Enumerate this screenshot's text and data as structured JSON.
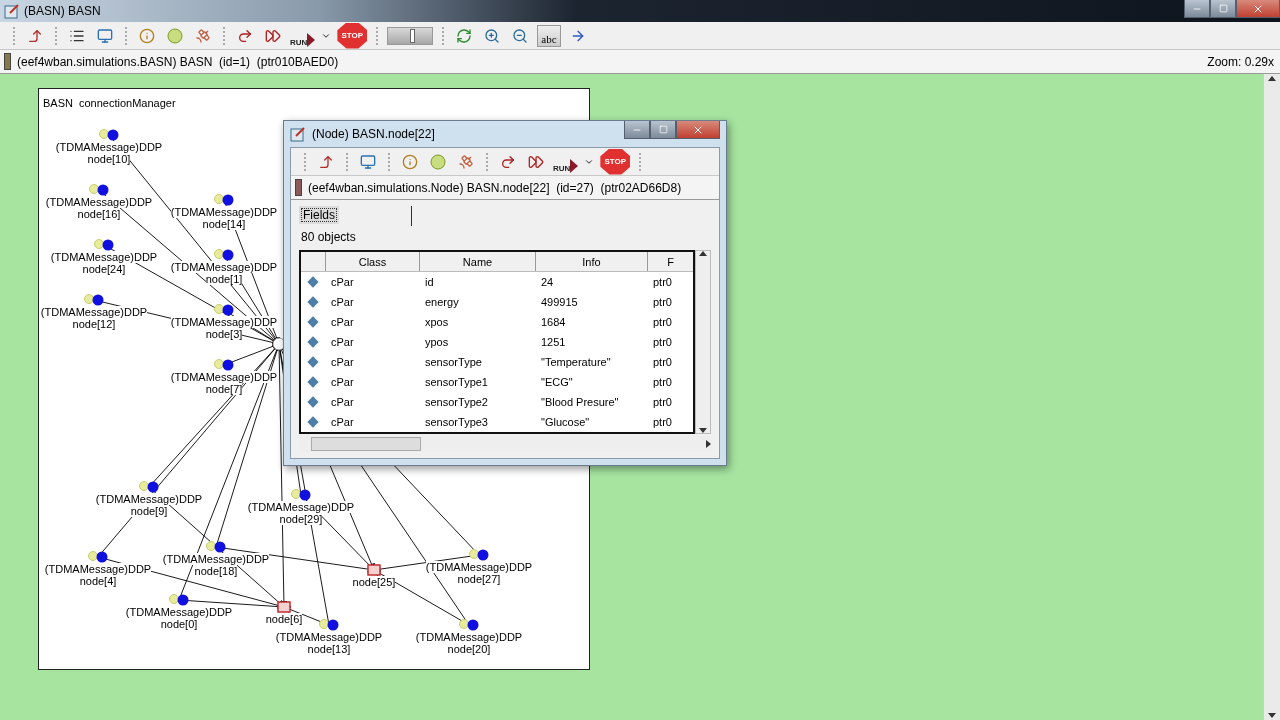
{
  "window": {
    "title": "(BASN) BASN"
  },
  "toolbar": {
    "run_label": "RUN",
    "stop_label": "STOP",
    "speed": {
      "level": 0.55
    },
    "labels_button": "abc"
  },
  "info_bar": {
    "text": "(eef4wban.simulations.BASN) BASN  (id=1)  (ptr010BAED0)",
    "zoom": "Zoom: 0.29x"
  },
  "canvas": {
    "title": "BASN",
    "module": "connectionManager",
    "nodes": [
      {
        "kind": "sensor",
        "label": "node[10]",
        "message": "(TDMAMessage)DDP"
      },
      {
        "kind": "sensor",
        "label": "node[16]",
        "message": "(TDMAMessage)DDP"
      },
      {
        "kind": "sensor",
        "label": "node[24]",
        "message": "(TDMAMessage)DDP"
      },
      {
        "kind": "sensor",
        "label": "node[12]",
        "message": "(TDMAMessage)DDP"
      },
      {
        "kind": "sensor",
        "label": "node[14]",
        "message": "(TDMAMessage)DDP"
      },
      {
        "kind": "sensor",
        "label": "node[1]",
        "message": "(TDMAMessage)DDP"
      },
      {
        "kind": "sensor",
        "label": "node[3]",
        "message": "(TDMAMessage)DDP"
      },
      {
        "kind": "sensor",
        "label": "node[7]",
        "message": "(TDMAMessage)DDP"
      },
      {
        "kind": "sensor",
        "label": "node[9]",
        "message": "(TDMAMessage)DDP"
      },
      {
        "kind": "sensor",
        "label": "node[29]",
        "message": "(TDMAMessage)DDP"
      },
      {
        "kind": "sensor",
        "label": "node[4]",
        "message": "(TDMAMessage)DDP"
      },
      {
        "kind": "sensor",
        "label": "node[18]",
        "message": "(TDMAMessage)DDP"
      },
      {
        "kind": "sensor",
        "label": "node[0]",
        "message": "(TDMAMessage)DDP"
      },
      {
        "kind": "sink",
        "label": "node[6]"
      },
      {
        "kind": "sink",
        "label": "node[25]"
      },
      {
        "kind": "sensor",
        "label": "node[27]",
        "message": "(TDMAMessage)DDP"
      },
      {
        "kind": "sensor",
        "label": "node[13]",
        "message": "(TDMAMessage)DDP"
      },
      {
        "kind": "sensor",
        "label": "node[20]",
        "message": "(TDMAMessage)DDP"
      }
    ]
  },
  "dialog": {
    "title": "(Node) BASN.node[22]",
    "run_label": "RUN",
    "stop_label": "STOP",
    "info": "(eef4wban.simulations.Node) BASN.node[22]  (id=27)  (ptr02AD66D8)",
    "tabs": [
      {
        "label": "Fields",
        "selected": true
      }
    ],
    "count": "80 objects",
    "table": {
      "columns": [
        "Class",
        "Name",
        "Info",
        "F"
      ],
      "rows": [
        [
          "cPar",
          "id",
          "24",
          "ptr0"
        ],
        [
          "cPar",
          "energy",
          "499915",
          "ptr0"
        ],
        [
          "cPar",
          "xpos",
          "1684",
          "ptr0"
        ],
        [
          "cPar",
          "ypos",
          "1251",
          "ptr0"
        ],
        [
          "cPar",
          "sensorType",
          "\"Temperature\"",
          "ptr0"
        ],
        [
          "cPar",
          "sensorType1",
          "\"ECG\"",
          "ptr0"
        ],
        [
          "cPar",
          "sensorType2",
          "\"Blood Presure\"",
          "ptr0"
        ],
        [
          "cPar",
          "sensorType3",
          "\"Glucose\"",
          "ptr0"
        ]
      ]
    }
  }
}
